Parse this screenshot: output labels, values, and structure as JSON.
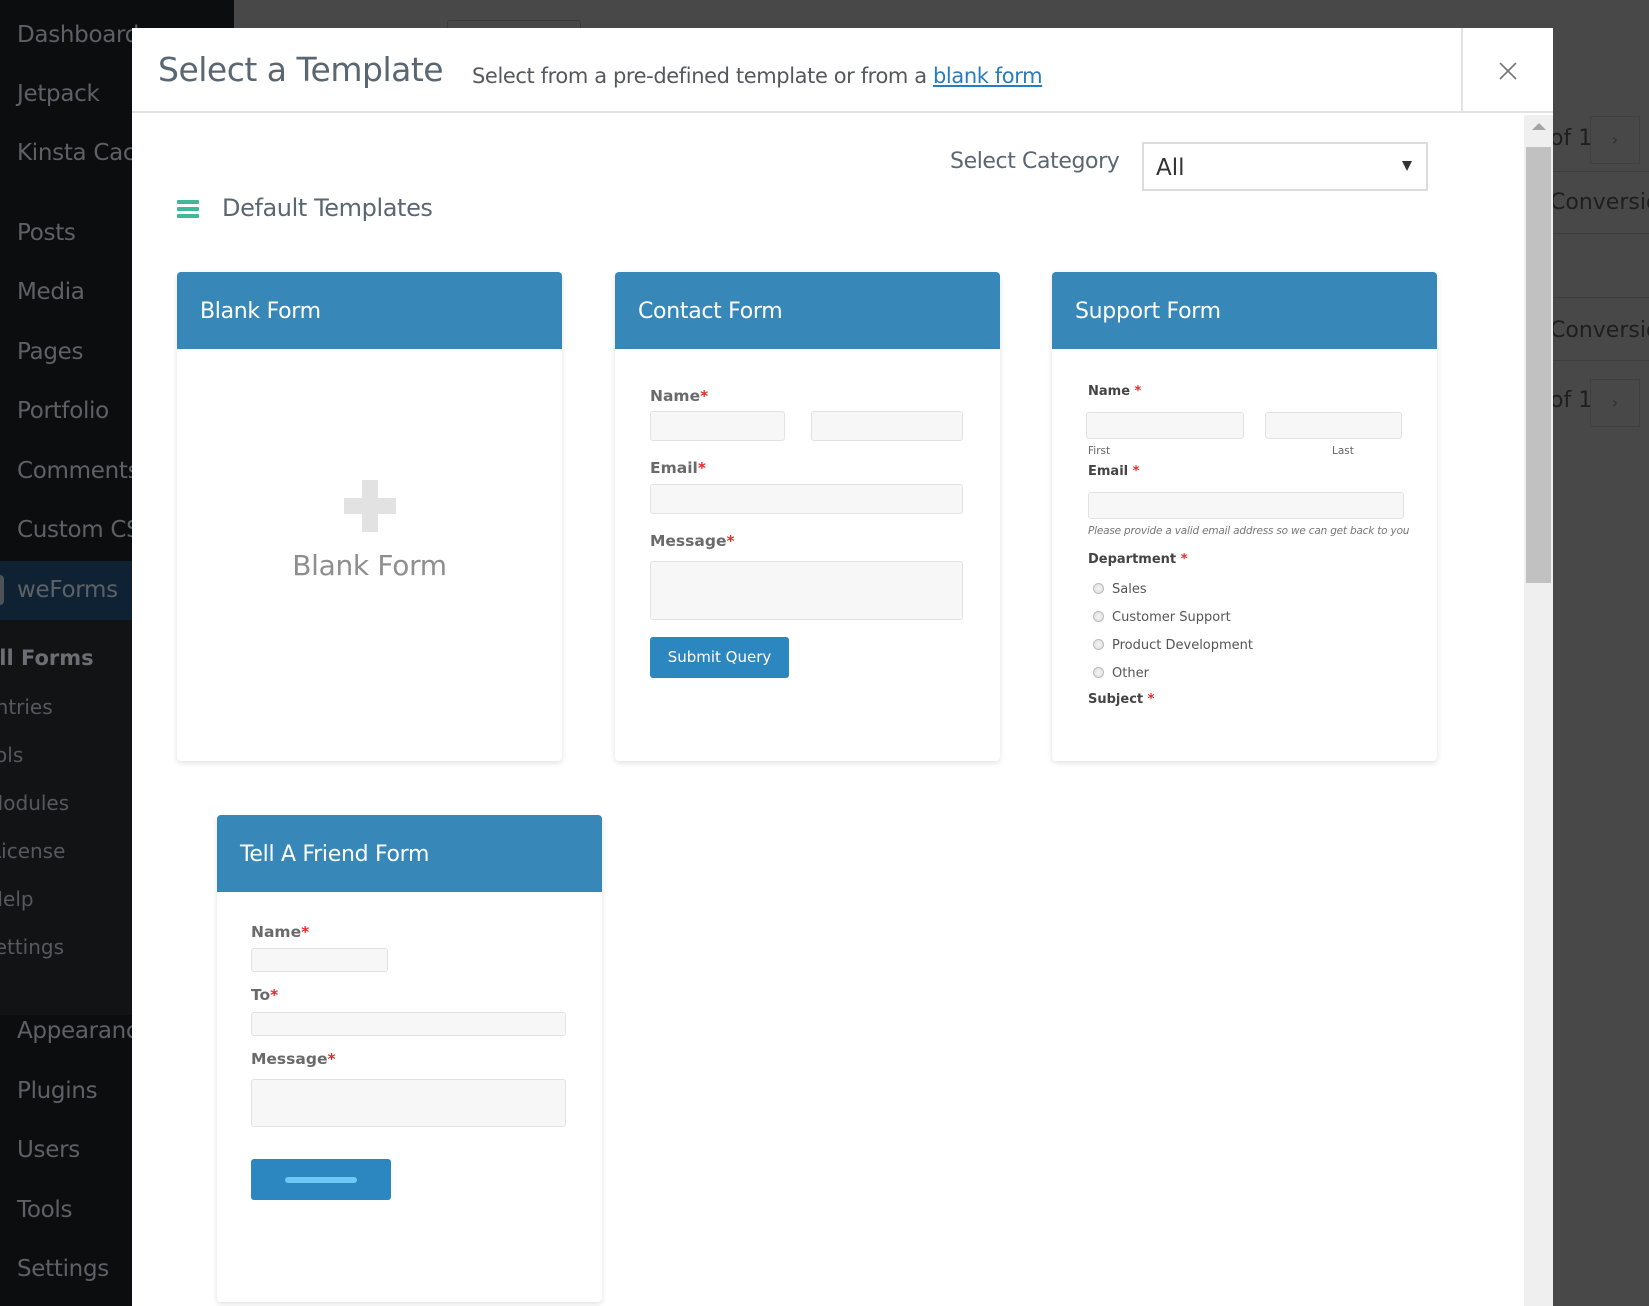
{
  "background": {
    "sidebar_items": [
      {
        "label": "Dashboard"
      },
      {
        "label": "Jetpack"
      },
      {
        "label": "Kinsta Cache"
      },
      {
        "label": "Posts"
      },
      {
        "label": "Media"
      },
      {
        "label": "Pages"
      },
      {
        "label": "Portfolio"
      },
      {
        "label": "Comments"
      },
      {
        "label": "Custom CSS"
      },
      {
        "label": "weForms"
      },
      {
        "label": "Appearance"
      },
      {
        "label": "Plugins"
      },
      {
        "label": "Users"
      },
      {
        "label": "Tools"
      },
      {
        "label": "Settings"
      }
    ],
    "submenu_items": [
      {
        "label": "All Forms"
      },
      {
        "label": "Entries"
      },
      {
        "label": "Tools"
      },
      {
        "label": "Modules"
      },
      {
        "label": "License"
      },
      {
        "label": "Help"
      },
      {
        "label": "Settings"
      }
    ],
    "right_content": {
      "pagination_text": "of 1",
      "next_label": "›",
      "column_text": "Conversion"
    }
  },
  "modal": {
    "title": "Select a Template",
    "subtitle_prefix": "Select from a pre-defined template or from a ",
    "subtitle_link": "blank form",
    "close_icon": "close-icon",
    "category_label": "Select Category",
    "category_value": "All",
    "section_title": "Default Templates",
    "section_icon": "list-icon",
    "accent_color": "#3787b9",
    "section_icon_color": "#3fb99a"
  },
  "templates": {
    "blank": {
      "title": "Blank Form",
      "body_label": "Blank Form"
    },
    "contact": {
      "title": "Contact Form",
      "fields": {
        "name": "Name",
        "email": "Email",
        "message": "Message"
      },
      "required_mark": "*",
      "submit_label": "Submit Query"
    },
    "support": {
      "title": "Support Form",
      "fields": {
        "name": "Name",
        "first": "First",
        "last": "Last",
        "email": "Email",
        "email_hint": "Please provide a valid email address so we can get back to you",
        "department": "Department",
        "subject": "Subject"
      },
      "required_mark": "*",
      "department_options": [
        "Sales",
        "Customer Support",
        "Product Development",
        "Other"
      ]
    },
    "tell_a_friend": {
      "title": "Tell A Friend Form",
      "fields": {
        "name": "Name",
        "to": "To",
        "message": "Message"
      },
      "required_mark": "*"
    }
  }
}
